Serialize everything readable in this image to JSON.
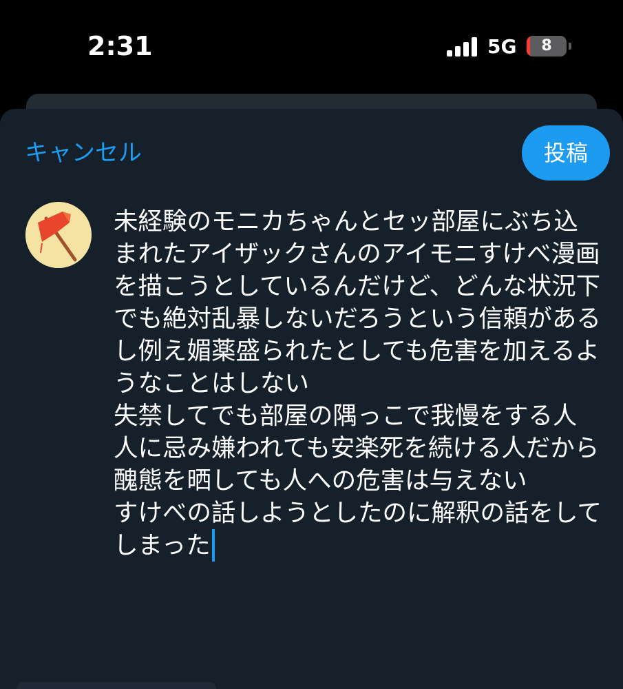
{
  "status_bar": {
    "time": "2:31",
    "network": "5G",
    "signal_bars": 4,
    "battery_level": "8"
  },
  "compose": {
    "cancel_label": "キャンセル",
    "post_label": "投稿",
    "avatar_icon": "red-flag-avatar-icon",
    "text": "未経験のモニカちゃんとセッ部屋にぶち込まれたアイザックさんのアイモニすけべ漫画を描こうとしているんだけど、どんな状況下でも絶対乱暴しないだろうという信頼があるし例え媚薬盛られたとしても危害を加えるようなことはしない\n失禁してでも部屋の隅っこで我慢をする人　人に忌み嫌われても安楽死を続ける人だから醜態を晒しても人への危害は与えない\nすけべの話しようとしたのに解釈の話をしてしまった"
  },
  "colors": {
    "accent": "#1d9bf0",
    "sheet_bg": "#15202b",
    "text": "#ffffff"
  }
}
